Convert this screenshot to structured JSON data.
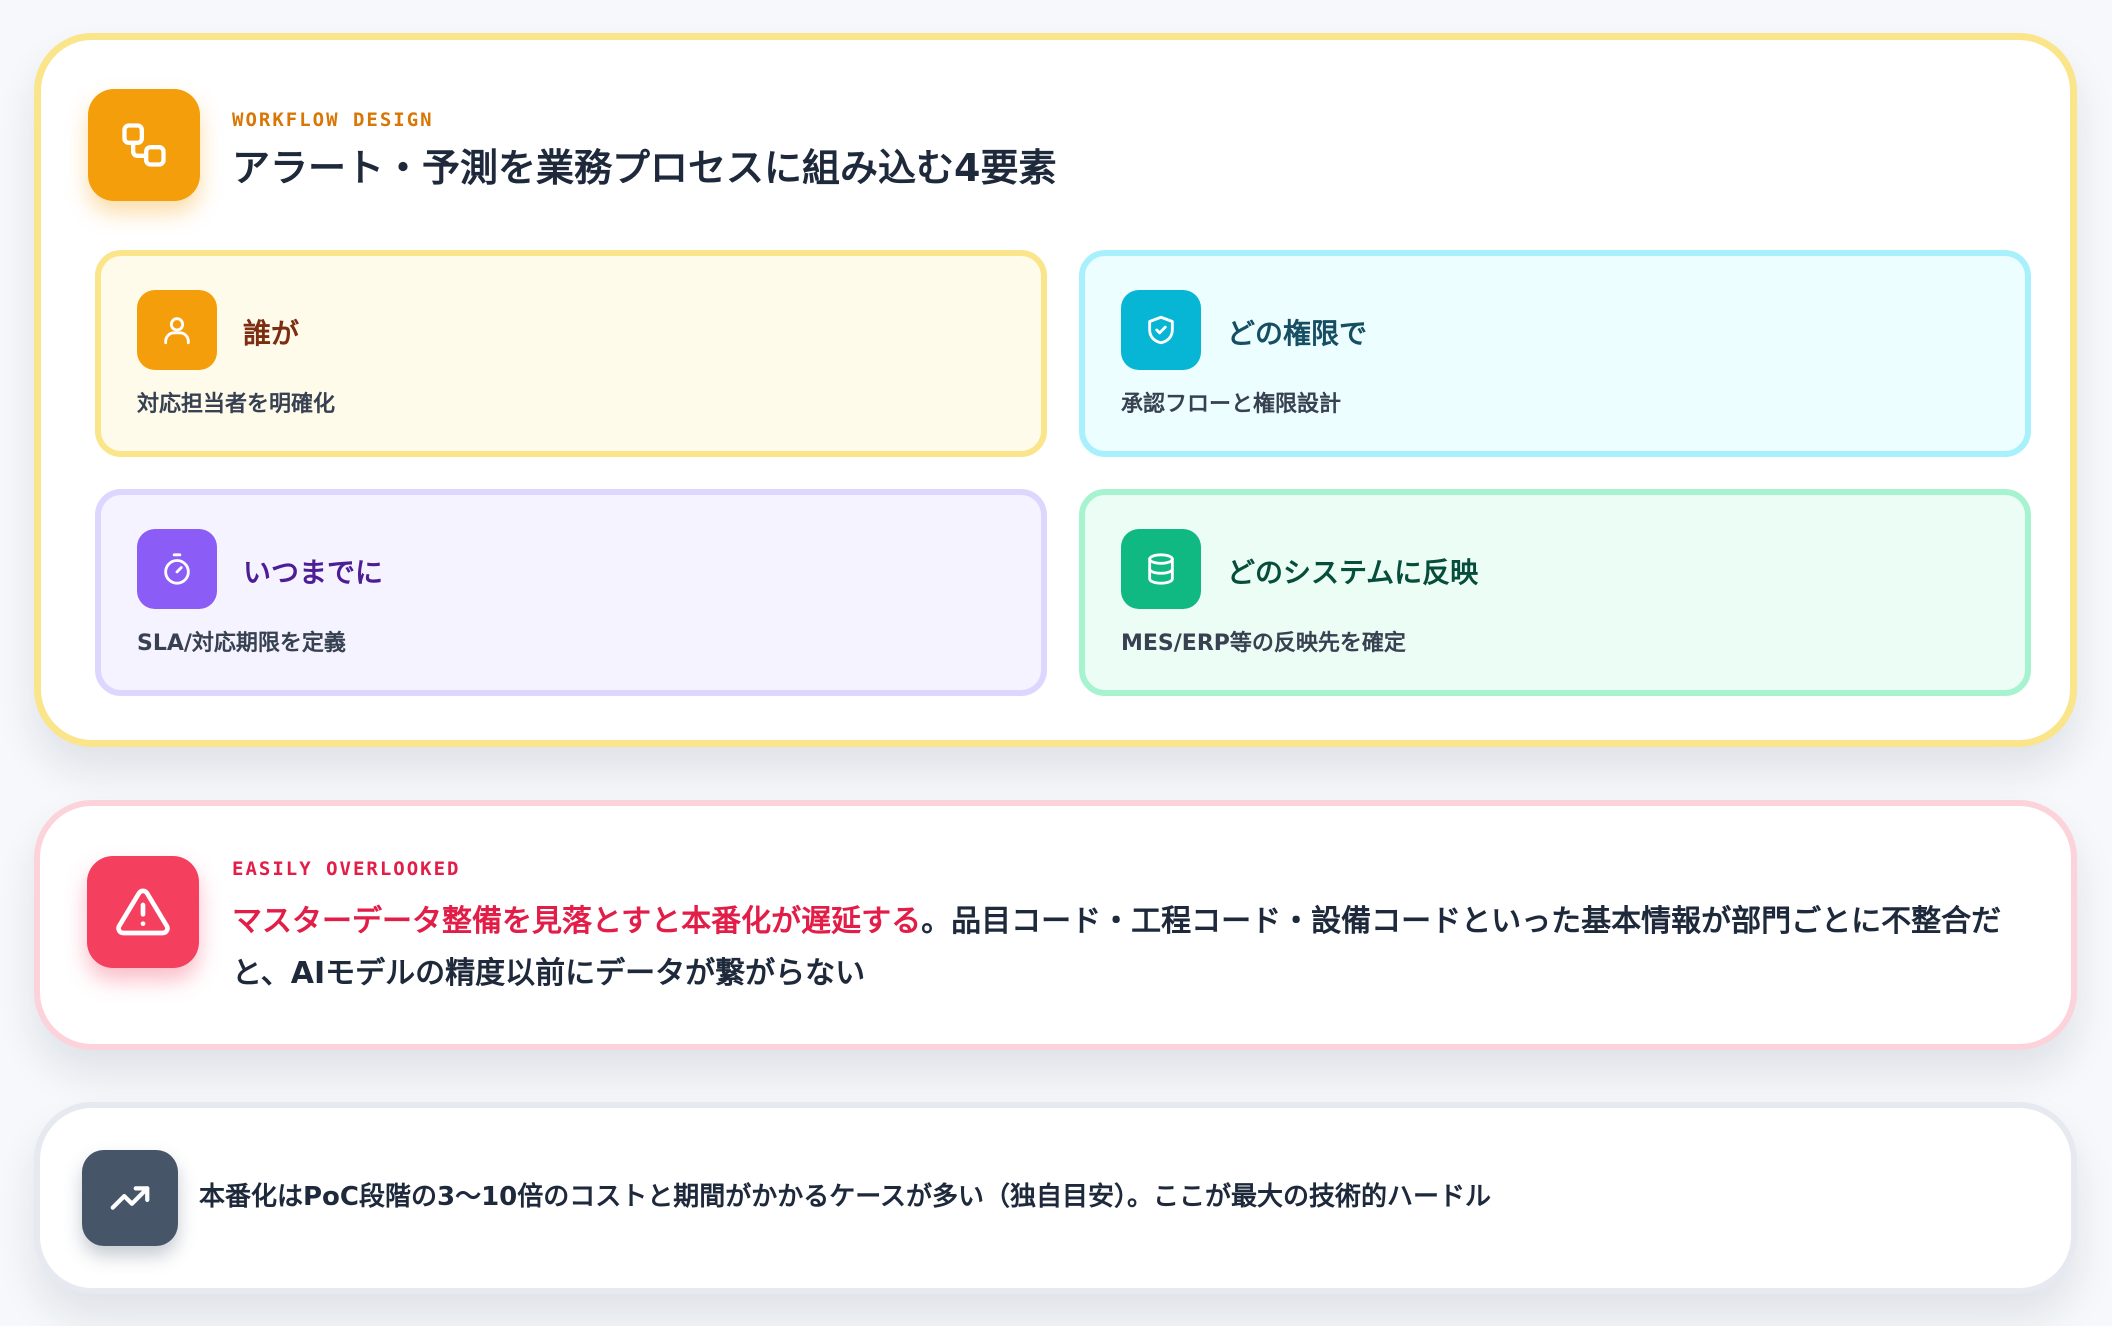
{
  "workflow": {
    "eyebrow": "WORKFLOW DESIGN",
    "title": "アラート・予測を業務プロセスに組み込む4要素",
    "icon": "workflow-icon",
    "accent": "#f59e0b",
    "cards": [
      {
        "title": "誰が",
        "desc": "対応担当者を明確化",
        "icon": "user-icon",
        "color": "#f59e0b",
        "title_color": "#7c2d12"
      },
      {
        "title": "どの権限で",
        "desc": "承認フローと権限設計",
        "icon": "shield-check-icon",
        "color": "#06b6d4",
        "title_color": "#164e63"
      },
      {
        "title": "いつまでに",
        "desc": "SLA/対応期限を定義",
        "icon": "timer-icon",
        "color": "#8b5cf6",
        "title_color": "#4c1d95"
      },
      {
        "title": "どのシステムに反映",
        "desc": "MES/ERP等の反映先を確定",
        "icon": "database-icon",
        "color": "#10b981",
        "title_color": "#064e3b"
      }
    ]
  },
  "warning": {
    "eyebrow": "EASILY OVERLOOKED",
    "highlight": "マスターデータ整備を見落とすと本番化が遅延する",
    "text": "。品目コード・工程コード・設備コードといった基本情報が部門ごとに不整合だと、AIモデルの精度以前にデータが繋がらない",
    "icon": "alert-triangle-icon",
    "accent": "#e11d48"
  },
  "note": {
    "text": "本番化はPoC段階の3〜10倍のコストと期間がかかるケースが多い（独自目安）。ここが最大の技術的ハードル",
    "icon": "trending-up-icon",
    "accent": "#475569"
  }
}
